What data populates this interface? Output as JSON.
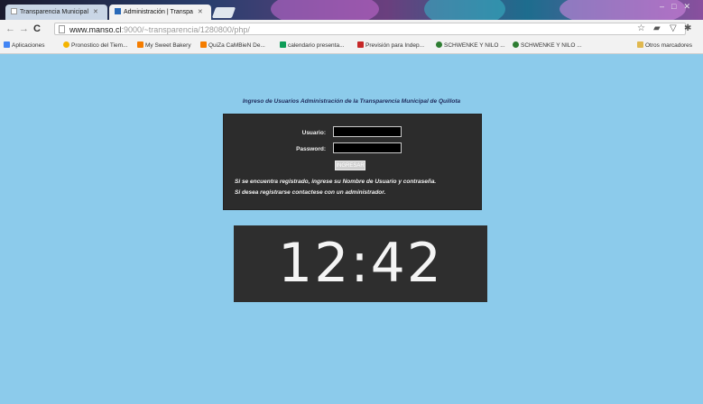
{
  "browser": {
    "tabs": [
      {
        "label": "Transparencia Municipal",
        "active": false
      },
      {
        "label": "Administración | Transpa",
        "active": true
      }
    ],
    "url": {
      "host": "www.manso.cl",
      "path": ":9000/~transparencia/1280800/php/"
    },
    "bookmarks": [
      {
        "label": "Aplicaciones",
        "icon": "apps-icon",
        "color": "#4285f4"
      },
      {
        "label": "Pronostico del Tiem...",
        "icon": "weather-icon",
        "color": "#f4b400"
      },
      {
        "label": "My Sweet Bakery",
        "icon": "blogger-icon",
        "color": "#f57d00"
      },
      {
        "label": "QuiZa CaMBieN De...",
        "icon": "blogger-icon",
        "color": "#f57d00"
      },
      {
        "label": "calendario presenta...",
        "icon": "sheet-icon",
        "color": "#0f9d58"
      },
      {
        "label": "Previsión para Indep...",
        "icon": "bookmark-icon",
        "color": "#c62828"
      },
      {
        "label": "SCHWENKE Y NILO ...",
        "icon": "leaf-icon",
        "color": "#2e7d32"
      },
      {
        "label": "SCHWENKE Y NILO ...",
        "icon": "leaf-icon",
        "color": "#2e7d32"
      },
      {
        "label": "Otros marcadores",
        "icon": "folder-icon",
        "color": "#e0b84f"
      }
    ]
  },
  "page": {
    "heading": "Ingreso de Usuarios Administración de la Transparencia Municipal de Quillota",
    "login": {
      "user_label": "Usuario:",
      "password_label": "Password:",
      "user_value": "",
      "password_value": "",
      "submit_label": "INGRESAR",
      "note_line1": "Si se encuentra registrado, ingrese su Nombre de Usuario y contraseña.",
      "note_line2": "Si desea registrarse contactese con un administrador."
    },
    "clock": "12:42"
  },
  "colors": {
    "page_background": "#8ccbeb",
    "panel_background": "#2c2c2c",
    "heading_text": "#1e2a5c"
  }
}
